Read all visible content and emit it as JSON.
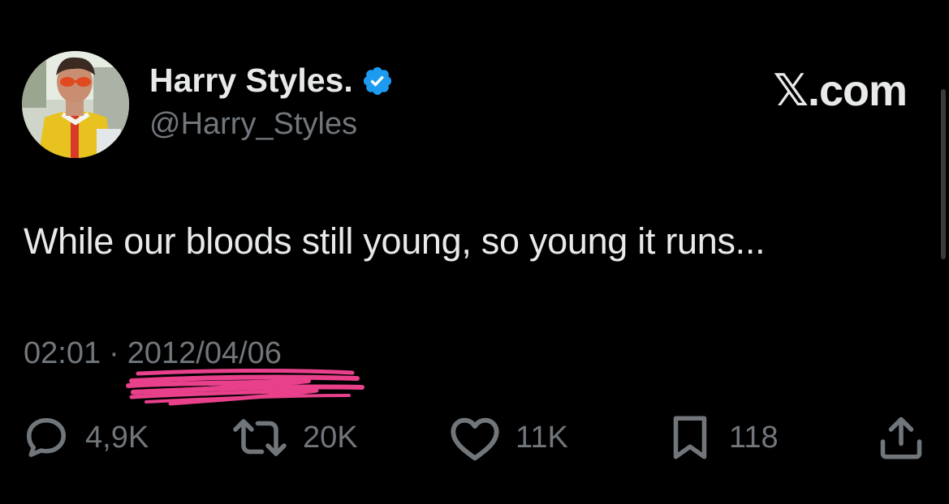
{
  "author": {
    "display_name": "Harry Styles.",
    "handle": "@Harry_Styles",
    "verified": true,
    "verified_badge_color": "#1d9bf0",
    "avatar_icon": "profile-photo"
  },
  "brand": "𝕏.com",
  "tweet": {
    "text": "While our bloods still young, so young it runs..."
  },
  "meta": {
    "time": "02:01",
    "separator": "·",
    "date": "2012/04/06",
    "annotation_color": "#e8408a"
  },
  "actions": {
    "reply": {
      "icon": "reply-icon",
      "count": "4,9K"
    },
    "retweet": {
      "icon": "retweet-icon",
      "count": "20K"
    },
    "like": {
      "icon": "heart-icon",
      "count": "11K"
    },
    "bookmark": {
      "icon": "bookmark-icon",
      "count": "118"
    },
    "share": {
      "icon": "share-icon"
    }
  },
  "colors": {
    "background": "#000000",
    "primary_text": "#e7e9ea",
    "secondary_text": "#71767b"
  }
}
